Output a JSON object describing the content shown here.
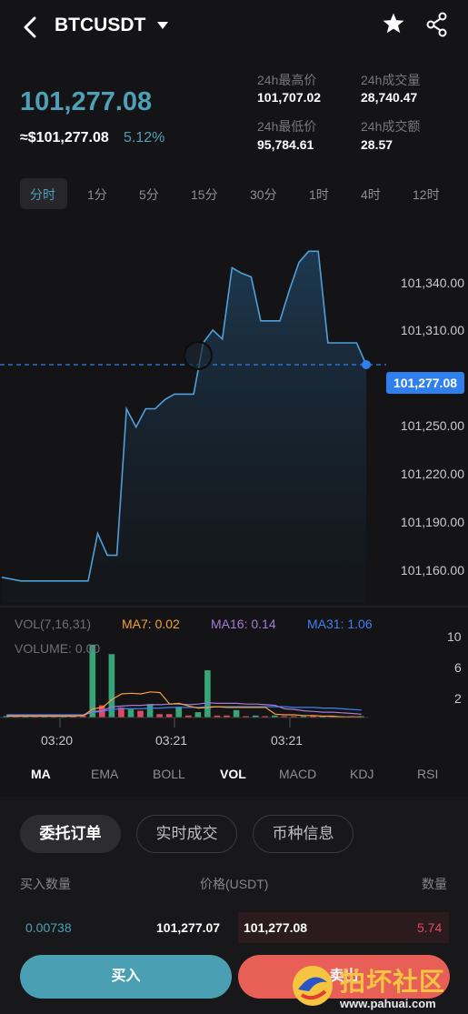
{
  "header": {
    "pair": "BTCUSDT"
  },
  "summary": {
    "price": "101,277.08",
    "approx": "≈$101,277.08",
    "change_pct": "5.12%",
    "stats": [
      {
        "label": "24h最高价",
        "value": "101,707.02"
      },
      {
        "label": "24h成交量",
        "value": "28,740.47"
      },
      {
        "label": "24h最低价",
        "value": "95,784.61"
      },
      {
        "label": "24h成交额",
        "value": "28.57"
      }
    ]
  },
  "intervals": [
    "分时",
    "1分",
    "5分",
    "15分",
    "30分",
    "1时",
    "4时",
    "12时"
  ],
  "chart_data": {
    "type": "area",
    "price_axis": [
      "101,340.00",
      "101,310.00",
      "101,250.00",
      "101,220.00",
      "101,190.00",
      "101,160.00"
    ],
    "ylim": [
      101147,
      101357
    ],
    "current_price": 101277.08,
    "current_label": "101,277.08",
    "values": [
      101161,
      101160,
      101159,
      101159,
      101159,
      101159,
      101159,
      101159,
      101159,
      101159,
      101185,
      101173,
      101173,
      101253,
      101243,
      101253,
      101253,
      101258,
      101261,
      101261,
      101261,
      101289,
      101296,
      101291,
      101330,
      101327,
      101325,
      101301,
      101301,
      101301,
      101318,
      101333,
      101339,
      101339,
      101289,
      101289,
      101289,
      101289,
      101277.08
    ],
    "volume": {
      "header": "VOL(7,16,31)",
      "ma7": "MA7: 0.02",
      "ma16": "MA16: 0.14",
      "ma31": "MA31: 1.06",
      "volume_label": "VOLUME: 0.00",
      "ticks": [
        "10",
        "6",
        "2"
      ],
      "ylim": [
        0,
        12
      ],
      "bars": [
        0.1,
        0.1,
        0.2,
        0.1,
        0.1,
        0.2,
        0.1,
        0.1,
        0.3,
        10.8,
        1.8,
        9.4,
        1.5,
        1.2,
        1.0,
        2.0,
        0.5,
        0.5,
        1.6,
        0.3,
        0.8,
        7.0,
        0.3,
        0.3,
        1.1,
        0.2,
        0.3,
        0.2,
        0.3,
        0.2,
        0.2,
        0.2,
        0.3,
        0.1,
        0.1,
        0.1,
        0.1,
        0.1
      ],
      "bar_colors": [
        "g",
        "r",
        "g",
        "r",
        "g",
        "r",
        "g",
        "r",
        "r",
        "g",
        "r",
        "g",
        "r",
        "g",
        "r",
        "g",
        "r",
        "r",
        "g",
        "r",
        "g",
        "g",
        "r",
        "r",
        "g",
        "r",
        "g",
        "r",
        "g",
        "r",
        "r",
        "g",
        "r",
        "g",
        "r",
        "g",
        "r",
        "g"
      ],
      "ma7_values": [
        0.2,
        0.2,
        0.2,
        0.2,
        0.2,
        0.2,
        0.2,
        0.2,
        0.3,
        1.3,
        1.5,
        2.7,
        3.5,
        3.6,
        3.5,
        3.8,
        3.7,
        2.0,
        2.1,
        1.7,
        1.4,
        1.5,
        1.6,
        1.5,
        1.5,
        1.5,
        1.5,
        1.5,
        0.5,
        0.4,
        0.4,
        0.3,
        0.3,
        0.2,
        0.2,
        0.1,
        0.1,
        0.1
      ],
      "ma16_values": [
        0.3,
        0.3,
        0.3,
        0.3,
        0.3,
        0.3,
        0.3,
        0.3,
        0.3,
        0.9,
        1.0,
        1.6,
        1.7,
        1.8,
        1.8,
        1.9,
        1.9,
        2.0,
        2.0,
        1.9,
        2.0,
        2.2,
        2.1,
        2.1,
        2.1,
        2.0,
        2.0,
        1.9,
        1.8,
        1.3,
        1.2,
        1.0,
        0.9,
        0.8,
        0.8,
        0.7,
        0.6,
        0.5
      ],
      "ma31_values": [
        0.4,
        0.4,
        0.4,
        0.4,
        0.4,
        0.4,
        0.4,
        0.4,
        0.4,
        0.8,
        0.9,
        1.2,
        1.3,
        1.3,
        1.3,
        1.4,
        1.4,
        1.5,
        1.5,
        1.5,
        1.5,
        1.6,
        1.6,
        1.6,
        1.6,
        1.6,
        1.6,
        1.6,
        1.6,
        1.6,
        1.5,
        1.5,
        1.5,
        1.4,
        1.4,
        1.3,
        1.2,
        1.1
      ]
    },
    "time_labels": [
      "03:20",
      "03:21",
      "03:21"
    ]
  },
  "indicators": [
    "MA",
    "EMA",
    "BOLL",
    "VOL",
    "MACD",
    "KDJ",
    "RSI"
  ],
  "order_tabs": [
    "委托订单",
    "实时成交",
    "币种信息"
  ],
  "order_columns": {
    "qty_buy": "买入数量",
    "price": "价格(USDT)",
    "qty": "数量"
  },
  "order_row": {
    "buy_qty": "0.00738",
    "buy_price": "101,277.07",
    "sell_price": "101,277.08",
    "sell_qty": "5.74"
  },
  "actions": {
    "buy": "买入",
    "sell": "卖出"
  },
  "watermark": {
    "title": "拍坏社区",
    "url": "www.pahuai.com"
  },
  "colors": {
    "accent": "#4ea0b7",
    "green": "#37a47a",
    "red": "#e0495f",
    "ma7": "#f2a13b",
    "ma16": "#a57ad8",
    "ma31": "#3b82f6",
    "blue": "#2f80ed"
  }
}
